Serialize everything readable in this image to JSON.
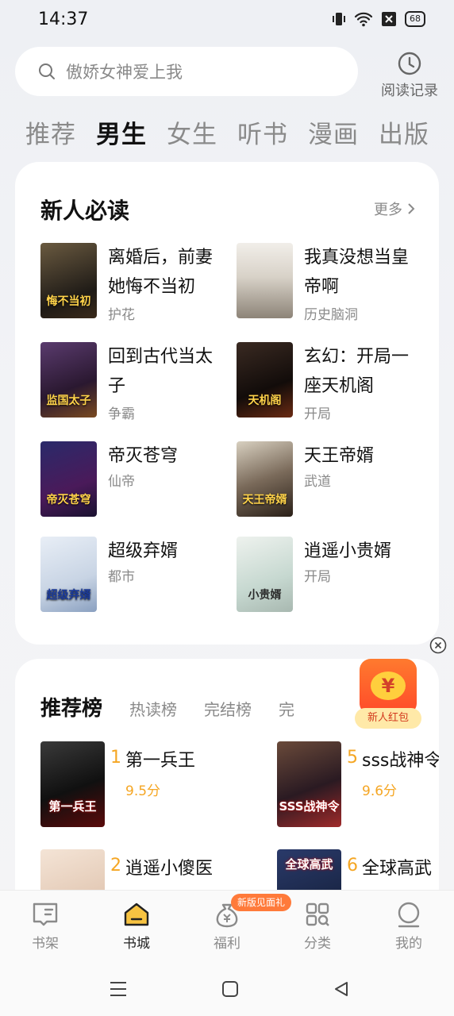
{
  "status": {
    "time": "14:37",
    "battery": "68"
  },
  "search": {
    "placeholder": "傲娇女神爱上我"
  },
  "history": {
    "label": "阅读记录"
  },
  "tabs": [
    "推荐",
    "男生",
    "女生",
    "听书",
    "漫画",
    "出版"
  ],
  "section_new": {
    "title": "新人必读",
    "more": "更多",
    "books": [
      {
        "title": "离婚后，前妻她悔不当初",
        "tag": "护花",
        "cover_text": "悔不当初"
      },
      {
        "title": "我真没想当皇帝啊",
        "tag": "历史脑洞",
        "cover_text": ""
      },
      {
        "title": "回到古代当太子",
        "tag": "争霸",
        "cover_text": "监国太子"
      },
      {
        "title": "玄幻：开局一座天机阁",
        "tag": "开局",
        "cover_text": "天机阁"
      },
      {
        "title": "帝灭苍穹",
        "tag": "仙帝",
        "cover_text": "帝灭苍穹"
      },
      {
        "title": "天王帝婿",
        "tag": "武道",
        "cover_text": "天王帝婿"
      },
      {
        "title": "超级弃婿",
        "tag": "都市",
        "cover_text": "超级弃婿"
      },
      {
        "title": "逍遥小贵婿",
        "tag": "开局",
        "cover_text": "小贵婿"
      }
    ]
  },
  "ranking": {
    "tabs": [
      "推荐榜",
      "热读榜",
      "完结榜",
      "完"
    ],
    "items": [
      {
        "rank": "1",
        "title": "第一兵王",
        "score": "9.5分",
        "cover_text": "第一兵王"
      },
      {
        "rank": "5",
        "title": "sss战神令",
        "score": "9.6分",
        "cover_text": "SSS战神令"
      },
      {
        "rank": "2",
        "title": "逍遥小傻医",
        "score": "",
        "cover_text": ""
      },
      {
        "rank": "6",
        "title": "全球高武",
        "score": "",
        "cover_text": "全球高武"
      }
    ]
  },
  "redpack": {
    "symbol": "¥",
    "label": "新人红包"
  },
  "bottom_nav": {
    "badge": "新版见面礼",
    "items": [
      {
        "label": "书架"
      },
      {
        "label": "书城"
      },
      {
        "label": "福利"
      },
      {
        "label": "分类"
      },
      {
        "label": "我的"
      }
    ]
  }
}
